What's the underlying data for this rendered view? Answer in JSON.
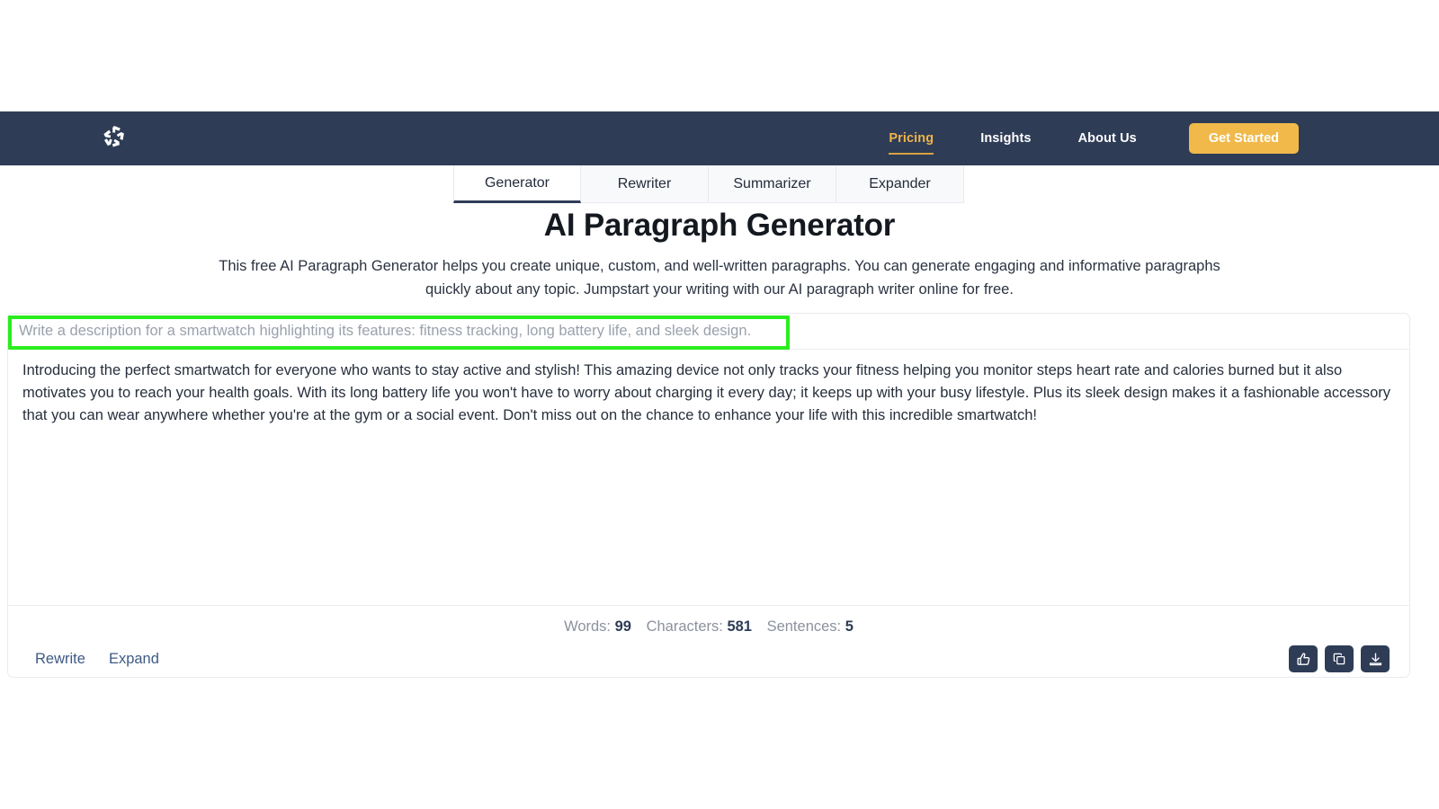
{
  "colors": {
    "navbar_bg": "#2e3c56",
    "accent_gold": "#f0b94a",
    "active_nav": "#efb548",
    "highlight_green": "#2bed1e",
    "panel_border": "#e9eaf1",
    "link_blue": "#3e5a85"
  },
  "header": {
    "logo_icon": "pinwheel-logo-icon",
    "nav": [
      {
        "label": "Pricing",
        "active": true
      },
      {
        "label": "Insights",
        "active": false
      },
      {
        "label": "About Us",
        "active": false
      }
    ],
    "cta_label": "Get Started"
  },
  "tabs": [
    {
      "label": "Generator",
      "active": true
    },
    {
      "label": "Rewriter",
      "active": false
    },
    {
      "label": "Summarizer",
      "active": false
    },
    {
      "label": "Expander",
      "active": false
    }
  ],
  "hero": {
    "title": "AI Paragraph Generator",
    "subtitle": "This free AI Paragraph Generator helps you create unique, custom, and well-written paragraphs. You can generate engaging and informative paragraphs quickly about any topic. Jumpstart your writing with our AI paragraph writer online for free."
  },
  "prompt": {
    "placeholder": "Write a description for a smartwatch highlighting its features: fitness tracking, long battery life, and sleek design.",
    "value": ""
  },
  "output": {
    "text": "Introducing the perfect smartwatch for everyone who wants to stay active and stylish! This amazing device not only tracks your fitness helping you monitor steps heart rate and calories burned but it also motivates you to reach your health goals. With its long battery life you won't have to worry about charging it every day; it keeps up with your busy lifestyle. Plus its sleek design makes it a fashionable accessory that you can wear anywhere whether you're at the gym or a social event. Don't miss out on the chance to enhance your life with this incredible smartwatch!"
  },
  "stats": {
    "words_label": "Words:",
    "words_value": "99",
    "characters_label": "Characters:",
    "characters_value": "581",
    "sentences_label": "Sentences:",
    "sentences_value": "5"
  },
  "footer": {
    "rewrite_label": "Rewrite",
    "expand_label": "Expand",
    "icons": [
      {
        "name": "thumbs-up-icon"
      },
      {
        "name": "copy-icon"
      },
      {
        "name": "download-icon"
      }
    ]
  }
}
